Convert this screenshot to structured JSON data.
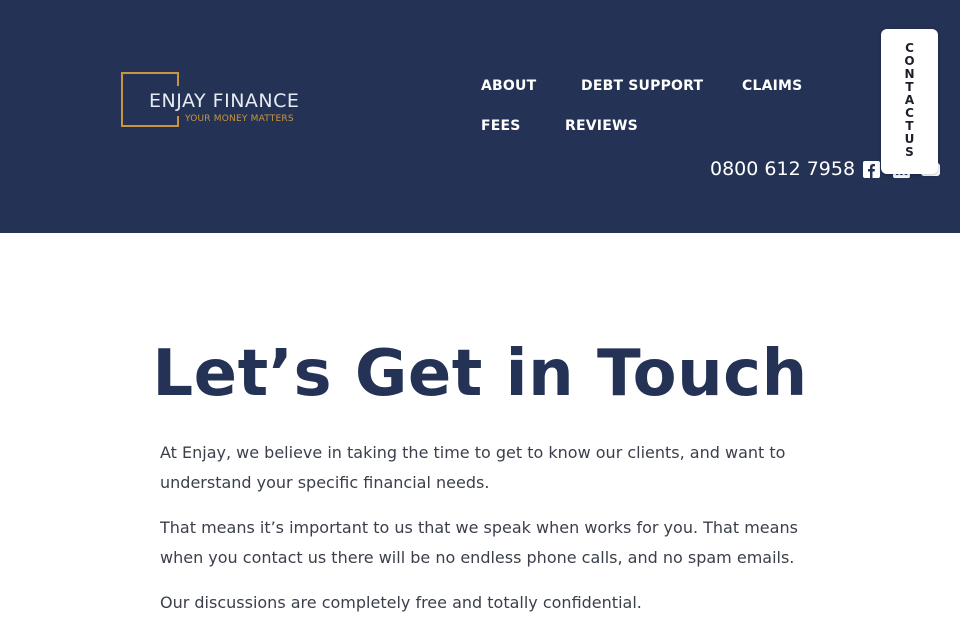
{
  "brand": {
    "name": "ENJAY FINANCE",
    "tagline": "YOUR MONEY MATTERS",
    "frame_color": "#c9963f"
  },
  "nav": {
    "items": [
      "ABOUT",
      "DEBT SUPPORT",
      "CLAIMS",
      "FEES",
      "REVIEWS"
    ]
  },
  "header": {
    "phone": "0800 612 7958",
    "social_icons": [
      "facebook-icon",
      "linkedin-icon",
      "youtube-icon"
    ],
    "background": "#243255"
  },
  "contact_tab": {
    "label": "CONTACT US"
  },
  "main": {
    "title": "Let’s Get in Touch",
    "paragraphs": [
      "At Enjay, we believe in taking the time to get to know our clients, and want to understand your specific financial needs.",
      "That means it’s important to us that we speak when works for you. That means when you contact us there will be no endless phone calls, and no spam emails.",
      "Our discussions are completely free and totally confidential."
    ]
  }
}
